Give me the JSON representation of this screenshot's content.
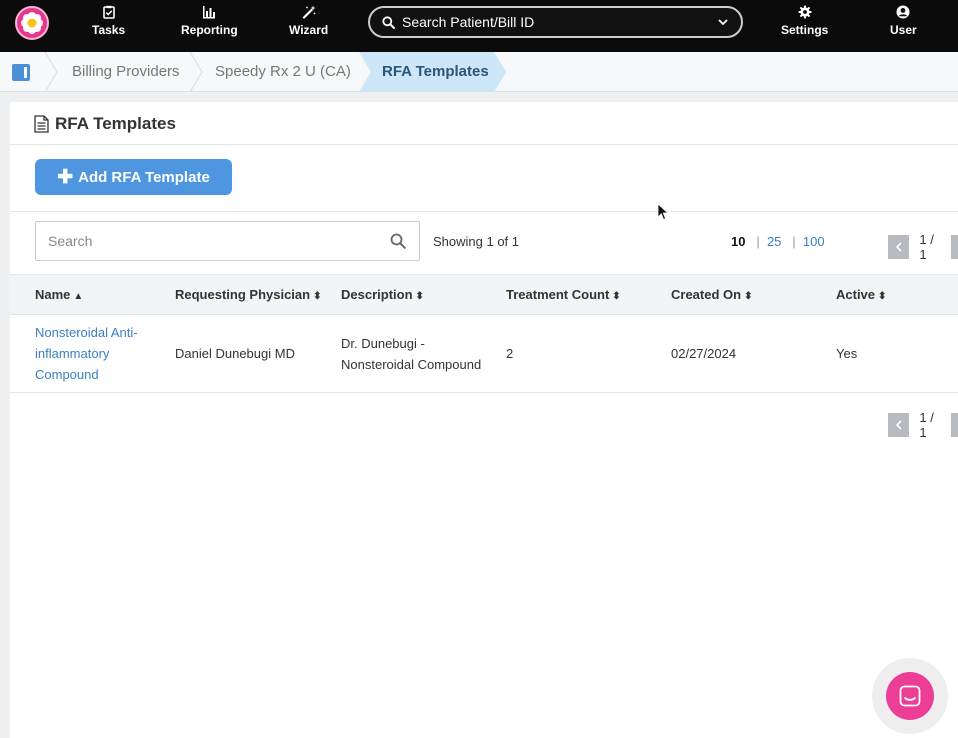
{
  "nav": {
    "items": [
      {
        "label": "Tasks",
        "icon": "clipboard-check-icon"
      },
      {
        "label": "Reporting",
        "icon": "bar-chart-icon"
      },
      {
        "label": "Wizard",
        "icon": "magic-wand-icon"
      },
      {
        "label": "Settings",
        "icon": "gear-icon"
      },
      {
        "label": "User",
        "icon": "user-circle-icon"
      }
    ],
    "search_label": "Search Patient/Bill ID"
  },
  "breadcrumb": {
    "items": [
      "Billing Providers",
      "Speedy Rx 2 U (CA)"
    ],
    "active": "RFA Templates"
  },
  "panel": {
    "title": "RFA Templates",
    "add_button": "Add RFA Template",
    "search_placeholder": "Search",
    "showing": "Showing 1 of 1",
    "page_sizes": [
      "10",
      "25",
      "100"
    ],
    "page_indicator": "1 / 1"
  },
  "table": {
    "columns": [
      "Name",
      "Requesting Physician",
      "Description",
      "Treatment Count",
      "Created On",
      "Active"
    ],
    "rows": [
      {
        "name_line1": "Nonsteroidal Anti-",
        "name_line2": "inflammatory",
        "name_line3": "Compound",
        "physician": "Daniel Dunebugi MD",
        "description_line1": "Dr. Dunebugi -",
        "description_line2": "Nonsteroidal Compound",
        "treatment_count": "2",
        "created_on": "02/27/2024",
        "active": "Yes"
      }
    ]
  },
  "colors": {
    "nav_bg": "#0b0b0b",
    "accent_blue": "#4e97e0",
    "link_blue": "#3a7fc4",
    "crumb_active_bg": "#cde6f8",
    "brand_pink": "#ec3e97"
  }
}
